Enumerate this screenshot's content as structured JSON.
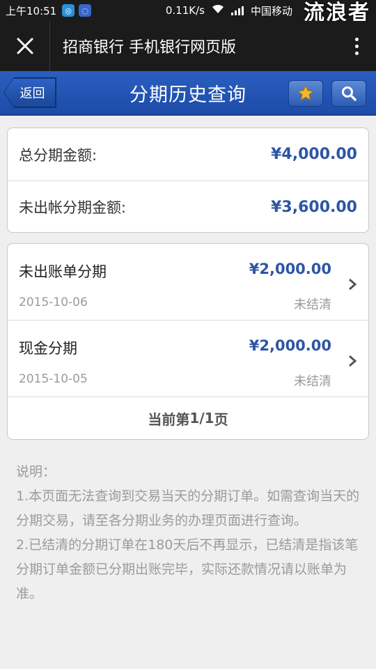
{
  "status_bar": {
    "time": "上午10:51",
    "speed": "0.11K/s",
    "carrier": "中国移动",
    "watermark": "流浪者"
  },
  "app_bar": {
    "title": "招商银行 手机银行网页版",
    "close_icon": "close-icon",
    "more_icon": "more-vert-icon"
  },
  "header": {
    "back_label": "返回",
    "title": "分期历史查询",
    "favorite_icon": "star-icon",
    "search_icon": "search-icon"
  },
  "summary": {
    "total_label": "总分期金额:",
    "total_value": "¥4,000.00",
    "unbilled_label": "未出帐分期金额:",
    "unbilled_value": "¥3,600.00"
  },
  "installments": [
    {
      "title": "未出账单分期",
      "amount": "¥2,000.00",
      "date": "2015-10-06",
      "status": "未结清"
    },
    {
      "title": "现金分期",
      "amount": "¥2,000.00",
      "date": "2015-10-05",
      "status": "未结清"
    }
  ],
  "pager": {
    "prefix": "当前第",
    "page": "1/1",
    "suffix": "页"
  },
  "notes": {
    "heading": "说明：",
    "items": [
      "1.本页面无法查询到交易当天的分期订单。如需查询当天的分期交易，请至各分期业务的办理页面进行查询。",
      "2.已结清的分期订单在180天后不再显示，已结清是指该笔分期订单金额已分期出账完毕，实际还款情况请以账单为准。"
    ]
  },
  "colors": {
    "header_blue": "#1d4ba8",
    "money_blue": "#2d56a4",
    "muted_gray": "#9a9a9a",
    "star_gold": "#f5b72a"
  }
}
